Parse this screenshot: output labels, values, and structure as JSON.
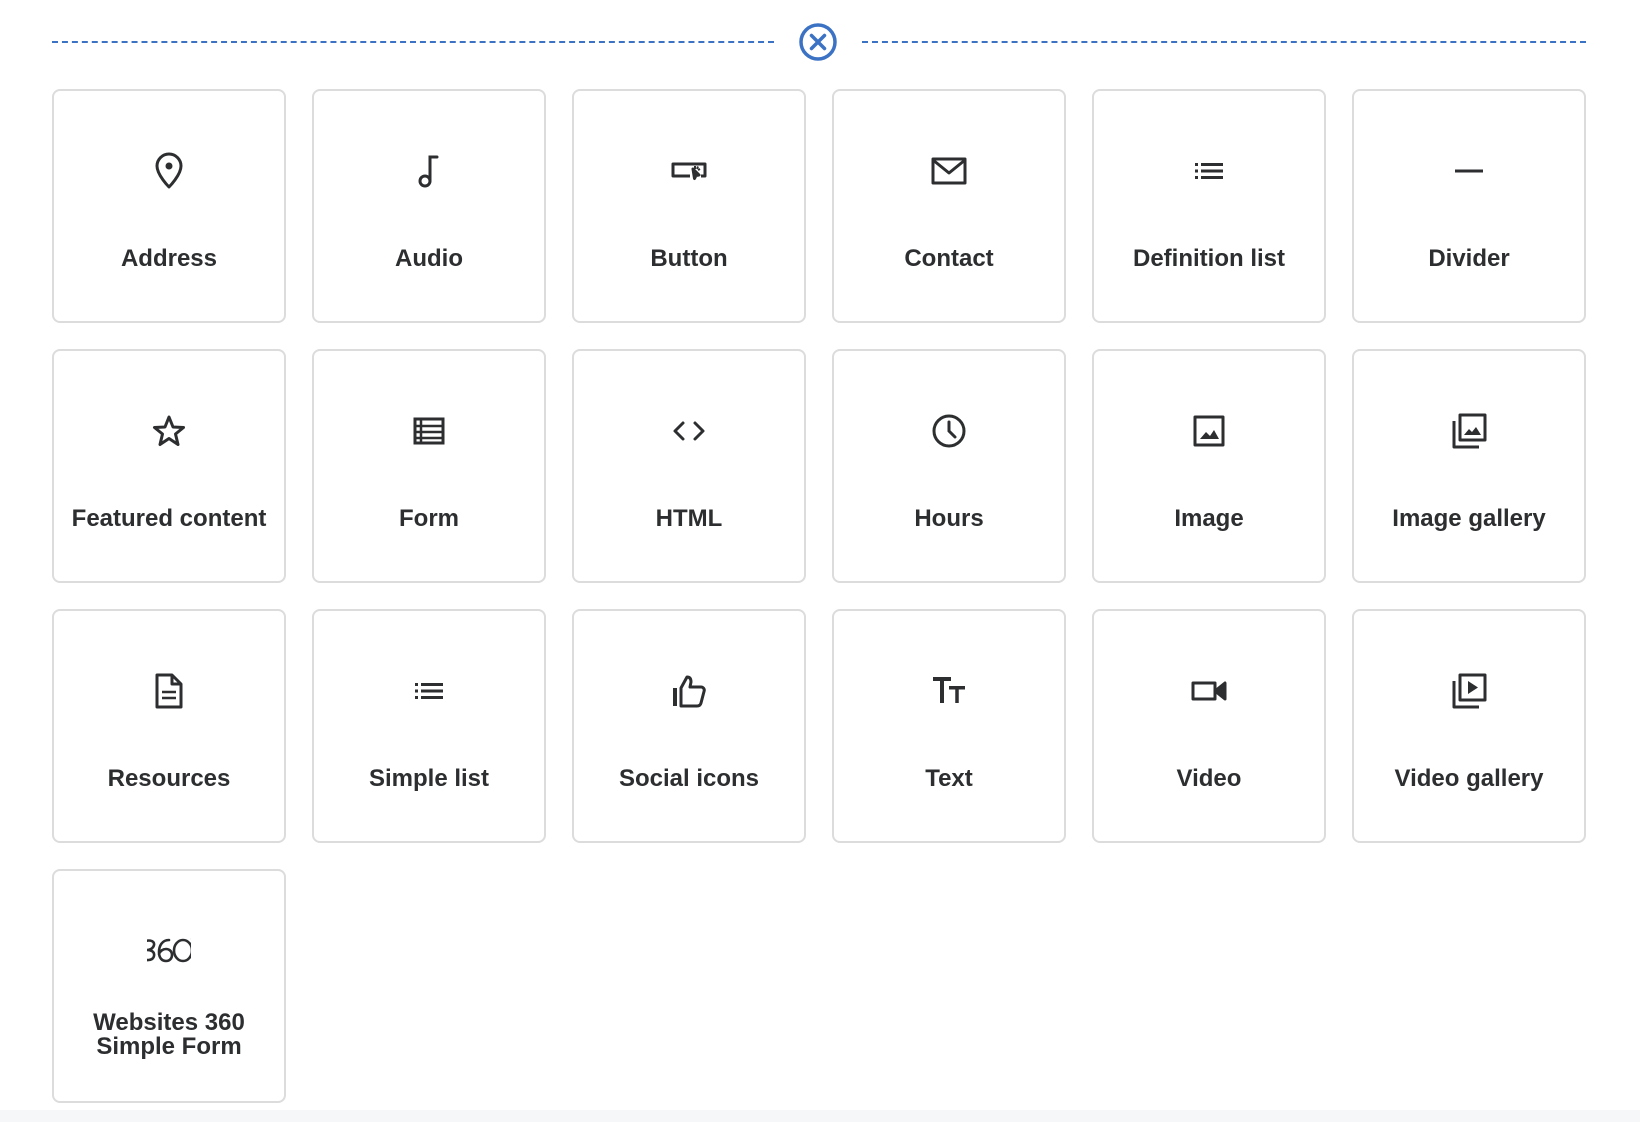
{
  "accent_color": "#3b72c4",
  "close_button": {
    "icon": "close-circle-icon"
  },
  "widgets": [
    {
      "key": "address",
      "label": "Address",
      "icon": "map-pin-icon"
    },
    {
      "key": "audio",
      "label": "Audio",
      "icon": "music-note-icon"
    },
    {
      "key": "button",
      "label": "Button",
      "icon": "button-icon"
    },
    {
      "key": "contact",
      "label": "Contact",
      "icon": "envelope-icon"
    },
    {
      "key": "definition-list",
      "label": "Definition list",
      "icon": "list-icon"
    },
    {
      "key": "divider",
      "label": "Divider",
      "icon": "horizontal-rule-icon"
    },
    {
      "key": "featured-content",
      "label": "Featured content",
      "icon": "star-icon"
    },
    {
      "key": "form",
      "label": "Form",
      "icon": "form-icon"
    },
    {
      "key": "html",
      "label": "HTML",
      "icon": "code-icon"
    },
    {
      "key": "hours",
      "label": "Hours",
      "icon": "clock-icon"
    },
    {
      "key": "image",
      "label": "Image",
      "icon": "image-icon"
    },
    {
      "key": "image-gallery",
      "label": "Image gallery",
      "icon": "image-gallery-icon"
    },
    {
      "key": "resources",
      "label": "Resources",
      "icon": "document-icon"
    },
    {
      "key": "simple-list",
      "label": "Simple list",
      "icon": "list-icon"
    },
    {
      "key": "social-icons",
      "label": "Social icons",
      "icon": "thumbs-up-icon"
    },
    {
      "key": "text",
      "label": "Text",
      "icon": "text-size-icon"
    },
    {
      "key": "video",
      "label": "Video",
      "icon": "video-camera-icon"
    },
    {
      "key": "video-gallery",
      "label": "Video gallery",
      "icon": "video-gallery-icon"
    },
    {
      "key": "websites-360-simple-form",
      "label": "Websites 360\nSimple Form",
      "icon": "logo-360-icon"
    }
  ]
}
